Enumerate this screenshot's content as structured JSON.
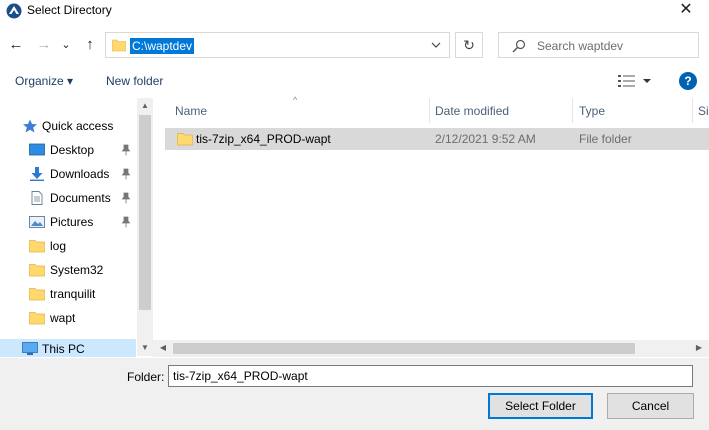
{
  "window": {
    "title": "Select Directory",
    "close_glyph": "✕",
    "icon": "app-logo-icon"
  },
  "nav": {
    "back_glyph": "←",
    "forward_glyph": "→",
    "recent_glyph": "⌄",
    "up_glyph": "↑",
    "address_value": "C:\\waptdev",
    "refresh_glyph": "↻",
    "search_placeholder": "Search waptdev"
  },
  "toolbar": {
    "organize_label": "Organize ▾",
    "new_folder_label": "New folder",
    "help_glyph": "?"
  },
  "sidebar": {
    "items": [
      {
        "label": "Quick access",
        "icon": "star-icon",
        "pinned": false
      },
      {
        "label": "Desktop",
        "icon": "desktop-icon",
        "pinned": true
      },
      {
        "label": "Downloads",
        "icon": "download-icon",
        "pinned": true
      },
      {
        "label": "Documents",
        "icon": "documents-icon",
        "pinned": true
      },
      {
        "label": "Pictures",
        "icon": "pictures-icon",
        "pinned": true
      },
      {
        "label": "log",
        "icon": "folder-icon",
        "pinned": false
      },
      {
        "label": "System32",
        "icon": "folder-icon",
        "pinned": false
      },
      {
        "label": "tranquilit",
        "icon": "folder-icon",
        "pinned": false
      },
      {
        "label": "wapt",
        "icon": "folder-icon",
        "pinned": false
      },
      {
        "label": "This PC",
        "icon": "computer-icon",
        "pinned": false
      }
    ]
  },
  "file_list": {
    "columns": {
      "name": "Name",
      "date_modified": "Date modified",
      "type": "Type",
      "size": "Si"
    },
    "rows": [
      {
        "name": "tis-7zip_x64_PROD-wapt",
        "date_modified": "2/12/2021 9:52 AM",
        "type": "File folder"
      }
    ]
  },
  "footer": {
    "folder_label": "Folder:",
    "folder_value": "tis-7zip_x64_PROD-wapt",
    "select_button": "Select Folder",
    "cancel_button": "Cancel"
  },
  "colors": {
    "accent": "#0078d7",
    "selection": "#cce8ff",
    "folder": "#ffd86e",
    "link_text": "#1e3f66"
  }
}
